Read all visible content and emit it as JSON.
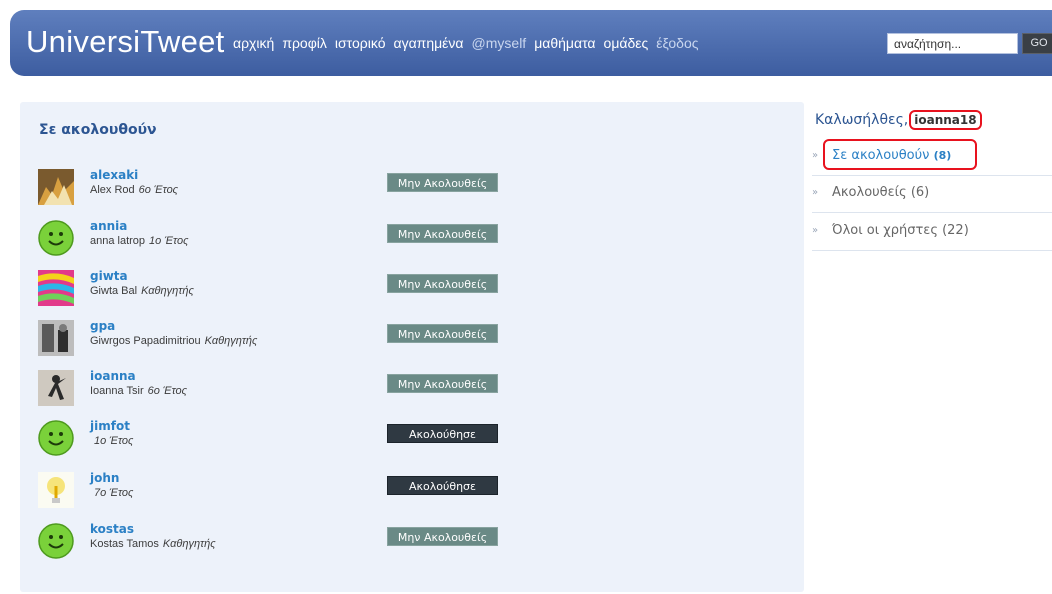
{
  "header": {
    "logo": "UniversiTweet",
    "nav": [
      {
        "label": "αρχική"
      },
      {
        "label": "προφίλ"
      },
      {
        "label": "ιστορικό"
      },
      {
        "label": "αγαπημένα"
      },
      {
        "label": "@myself"
      },
      {
        "label": "μαθήματα"
      },
      {
        "label": "ομάδες"
      },
      {
        "label": "έξοδος"
      }
    ],
    "search_value": "αναζήτηση...",
    "go_label": "GO"
  },
  "main": {
    "title": "Σε ακολουθούν",
    "rows": [
      {
        "username": "alexaki",
        "name": "Alex Rod",
        "role": "6ο Έτος",
        "button": "Μην Ακολουθείς",
        "button_type": "unfollow",
        "avatar": "fire-image"
      },
      {
        "username": "annia",
        "name": "anna latrop",
        "role": "1ο Έτος",
        "button": "Μην Ακολουθείς",
        "button_type": "unfollow",
        "avatar": "smiley-icon"
      },
      {
        "username": "giwta",
        "name": "Giwta Bal",
        "role": "Καθηγητής",
        "button": "Μην Ακολουθείς",
        "button_type": "unfollow",
        "avatar": "psychedelic-image"
      },
      {
        "username": "gpa",
        "name": "Giwrgos Papadimitriou",
        "role": "Καθηγητής",
        "button": "Μην Ακολουθείς",
        "button_type": "unfollow",
        "avatar": "bw-photo-image"
      },
      {
        "username": "ioanna",
        "name": "Ioanna Tsir",
        "role": "6ο Έτος",
        "button": "Μην Ακολουθείς",
        "button_type": "unfollow",
        "avatar": "dancer-image"
      },
      {
        "username": "jimfot",
        "name": "",
        "role": "1ο Έτος",
        "button": "Ακολούθησε",
        "button_type": "follow",
        "avatar": "smiley-icon"
      },
      {
        "username": "john",
        "name": "",
        "role": "7ο Έτος",
        "button": "Ακολούθησε",
        "button_type": "follow",
        "avatar": "lightbulb-icon"
      },
      {
        "username": "kostas",
        "name": "Kostas Tamos",
        "role": "Καθηγητής",
        "button": "Μην Ακολουθείς",
        "button_type": "unfollow",
        "avatar": "smiley-icon"
      }
    ]
  },
  "sidebar": {
    "welcome": "Καλωσήλθες,",
    "username": "ioanna18",
    "items": [
      {
        "label": "Σε ακολουθούν",
        "count": "(8)",
        "active": true
      },
      {
        "label": "Ακολουθείς",
        "count": "(6)",
        "active": false
      },
      {
        "label": "Όλοι οι χρήστες",
        "count": "(22)",
        "active": false
      }
    ]
  },
  "colors": {
    "header": "#4c6cb0",
    "panel": "#edf2fa",
    "link": "#2b80c5",
    "highlight": "#e8121e"
  }
}
